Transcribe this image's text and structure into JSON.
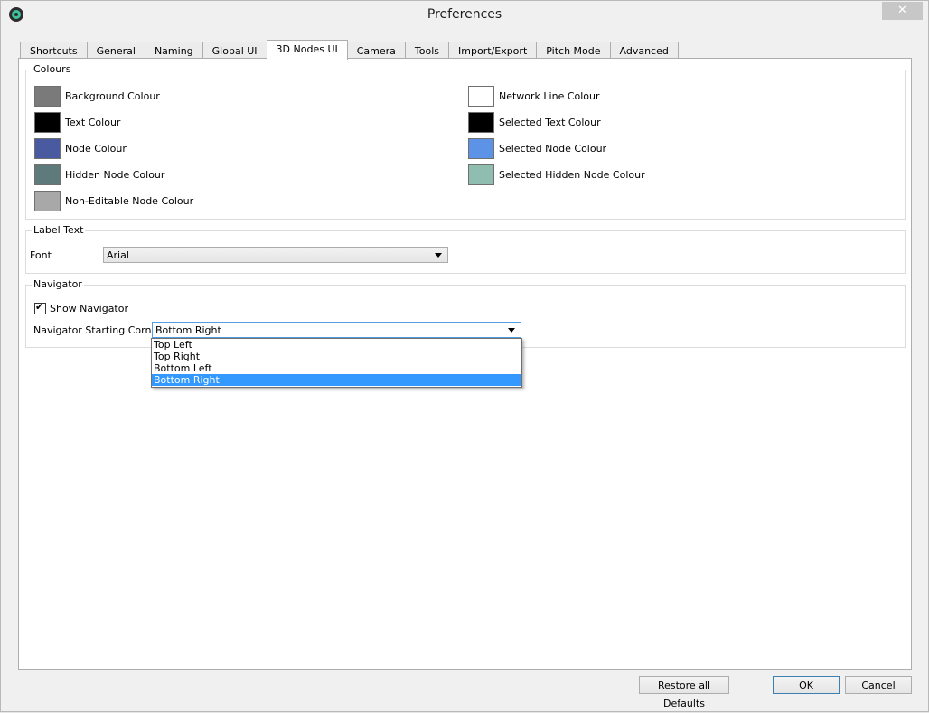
{
  "window": {
    "title": "Preferences",
    "close_glyph": "✕"
  },
  "tabs": [
    {
      "label": "Shortcuts"
    },
    {
      "label": "General"
    },
    {
      "label": "Naming"
    },
    {
      "label": "Global UI"
    },
    {
      "label": "3D Nodes UI",
      "active": true
    },
    {
      "label": "Camera"
    },
    {
      "label": "Tools"
    },
    {
      "label": "Import/Export"
    },
    {
      "label": "Pitch Mode"
    },
    {
      "label": "Advanced"
    }
  ],
  "colours": {
    "title": "Colours",
    "left": [
      {
        "label": "Background Colour",
        "color": "#7a7a7a"
      },
      {
        "label": "Text Colour",
        "color": "#000000"
      },
      {
        "label": "Node Colour",
        "color": "#4a5aa0"
      },
      {
        "label": "Hidden Node Colour",
        "color": "#5f7a7a"
      },
      {
        "label": "Non-Editable Node Colour",
        "color": "#a8a8a8"
      }
    ],
    "right": [
      {
        "label": "Network Line Colour",
        "color": "#ffffff"
      },
      {
        "label": "Selected Text Colour",
        "color": "#000000"
      },
      {
        "label": "Selected Node Colour",
        "color": "#5d93e6"
      },
      {
        "label": "Selected Hidden Node Colour",
        "color": "#8fbdb0"
      }
    ]
  },
  "label_text": {
    "title": "Label Text",
    "font_label": "Font",
    "font_value": "Arial"
  },
  "navigator": {
    "title": "Navigator",
    "show_label": "Show Navigator",
    "show_checked": true,
    "corner_label": "Navigator Starting Corner",
    "corner_value": "Bottom Right",
    "options": [
      "Top Left",
      "Top Right",
      "Bottom Left",
      "Bottom Right"
    ],
    "selected_option": "Bottom Right"
  },
  "buttons": {
    "restore": "Restore all Defaults",
    "ok": "OK",
    "cancel": "Cancel"
  }
}
